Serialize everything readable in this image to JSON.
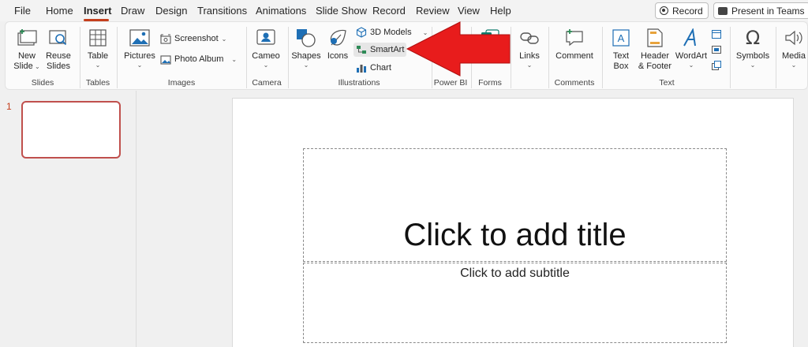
{
  "menu": {
    "tabs": [
      "File",
      "Home",
      "Insert",
      "Draw",
      "Design",
      "Transitions",
      "Animations",
      "Slide Show",
      "Record",
      "Review",
      "View",
      "Help"
    ],
    "active_tab": "Insert",
    "record_label": "Record",
    "present_label": "Present in Teams"
  },
  "ribbon": {
    "groups": {
      "slides": "Slides",
      "tables": "Tables",
      "images": "Images",
      "camera": "Camera",
      "illustrations": "Illustrations",
      "powerbi": "Power BI",
      "forms": "Forms",
      "comments": "Comments",
      "text": "Text"
    },
    "buttons": {
      "new_slide_1": "New",
      "new_slide_2": "Slide",
      "reuse_1": "Reuse",
      "reuse_2": "Slides",
      "table": "Table",
      "pictures": "Pictures",
      "screenshot": "Screenshot",
      "photo_album": "Photo Album",
      "cameo": "Cameo",
      "shapes": "Shapes",
      "icons": "Icons",
      "models_3d": "3D Models",
      "smartart": "SmartArt",
      "chart": "Chart",
      "forms": "Forms",
      "links": "Links",
      "comment": "Comment",
      "text_box_1": "Text",
      "text_box_2": "Box",
      "header_1": "Header",
      "header_2": "& Footer",
      "wordart": "WordArt",
      "symbols": "Symbols",
      "media": "Media"
    }
  },
  "slides_panel": {
    "number": "1"
  },
  "slide": {
    "title_placeholder": "Click to add title",
    "subtitle_placeholder": "Click to add subtitle"
  },
  "colors": {
    "accent": "#c43e1c",
    "arrow": "#e81c1c"
  }
}
